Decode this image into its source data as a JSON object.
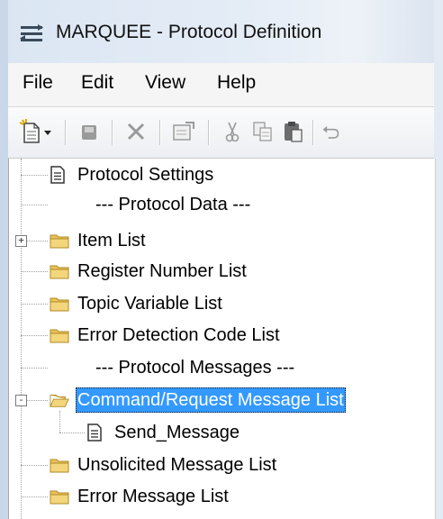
{
  "window": {
    "title": "MARQUEE - Protocol Definition",
    "icon": "protocol-list-icon"
  },
  "menu": {
    "items": [
      {
        "label": "File"
      },
      {
        "label": "Edit"
      },
      {
        "label": "View"
      },
      {
        "label": "Help"
      }
    ]
  },
  "toolbar": {
    "buttons": [
      {
        "name": "new-dropdown",
        "icon": "new-document-icon"
      },
      {
        "name": "save",
        "icon": "save-icon",
        "enabled": false
      },
      {
        "name": "delete",
        "icon": "delete-x-icon",
        "enabled": false
      },
      {
        "name": "properties",
        "icon": "properties-icon",
        "enabled": false
      },
      {
        "name": "cut",
        "icon": "cut-icon",
        "enabled": false
      },
      {
        "name": "copy",
        "icon": "copy-icon",
        "enabled": false
      },
      {
        "name": "paste",
        "icon": "paste-icon",
        "enabled": true
      },
      {
        "name": "undo",
        "icon": "undo-icon",
        "enabled": false
      }
    ]
  },
  "tree": {
    "nodes": [
      {
        "label": "Protocol Settings",
        "icon": "document-icon"
      },
      {
        "label": "--- Protocol Data ---",
        "icon": "none"
      },
      {
        "label": "Item List",
        "icon": "folder-icon",
        "expander": "+"
      },
      {
        "label": "Register Number List",
        "icon": "folder-icon"
      },
      {
        "label": "Topic Variable List",
        "icon": "folder-icon"
      },
      {
        "label": "Error Detection Code List",
        "icon": "folder-icon"
      },
      {
        "label": "--- Protocol Messages ---",
        "icon": "none"
      },
      {
        "label": "Command/Request Message List",
        "icon": "folder-open-icon",
        "expander": "-",
        "selected": true
      },
      {
        "label": "Send_Message",
        "icon": "document-icon"
      },
      {
        "label": "Unsolicited Message List",
        "icon": "folder-icon"
      },
      {
        "label": "Error Message List",
        "icon": "folder-icon"
      }
    ]
  },
  "colors": {
    "selection": "#3399ff",
    "folder": "#e8c25a"
  }
}
